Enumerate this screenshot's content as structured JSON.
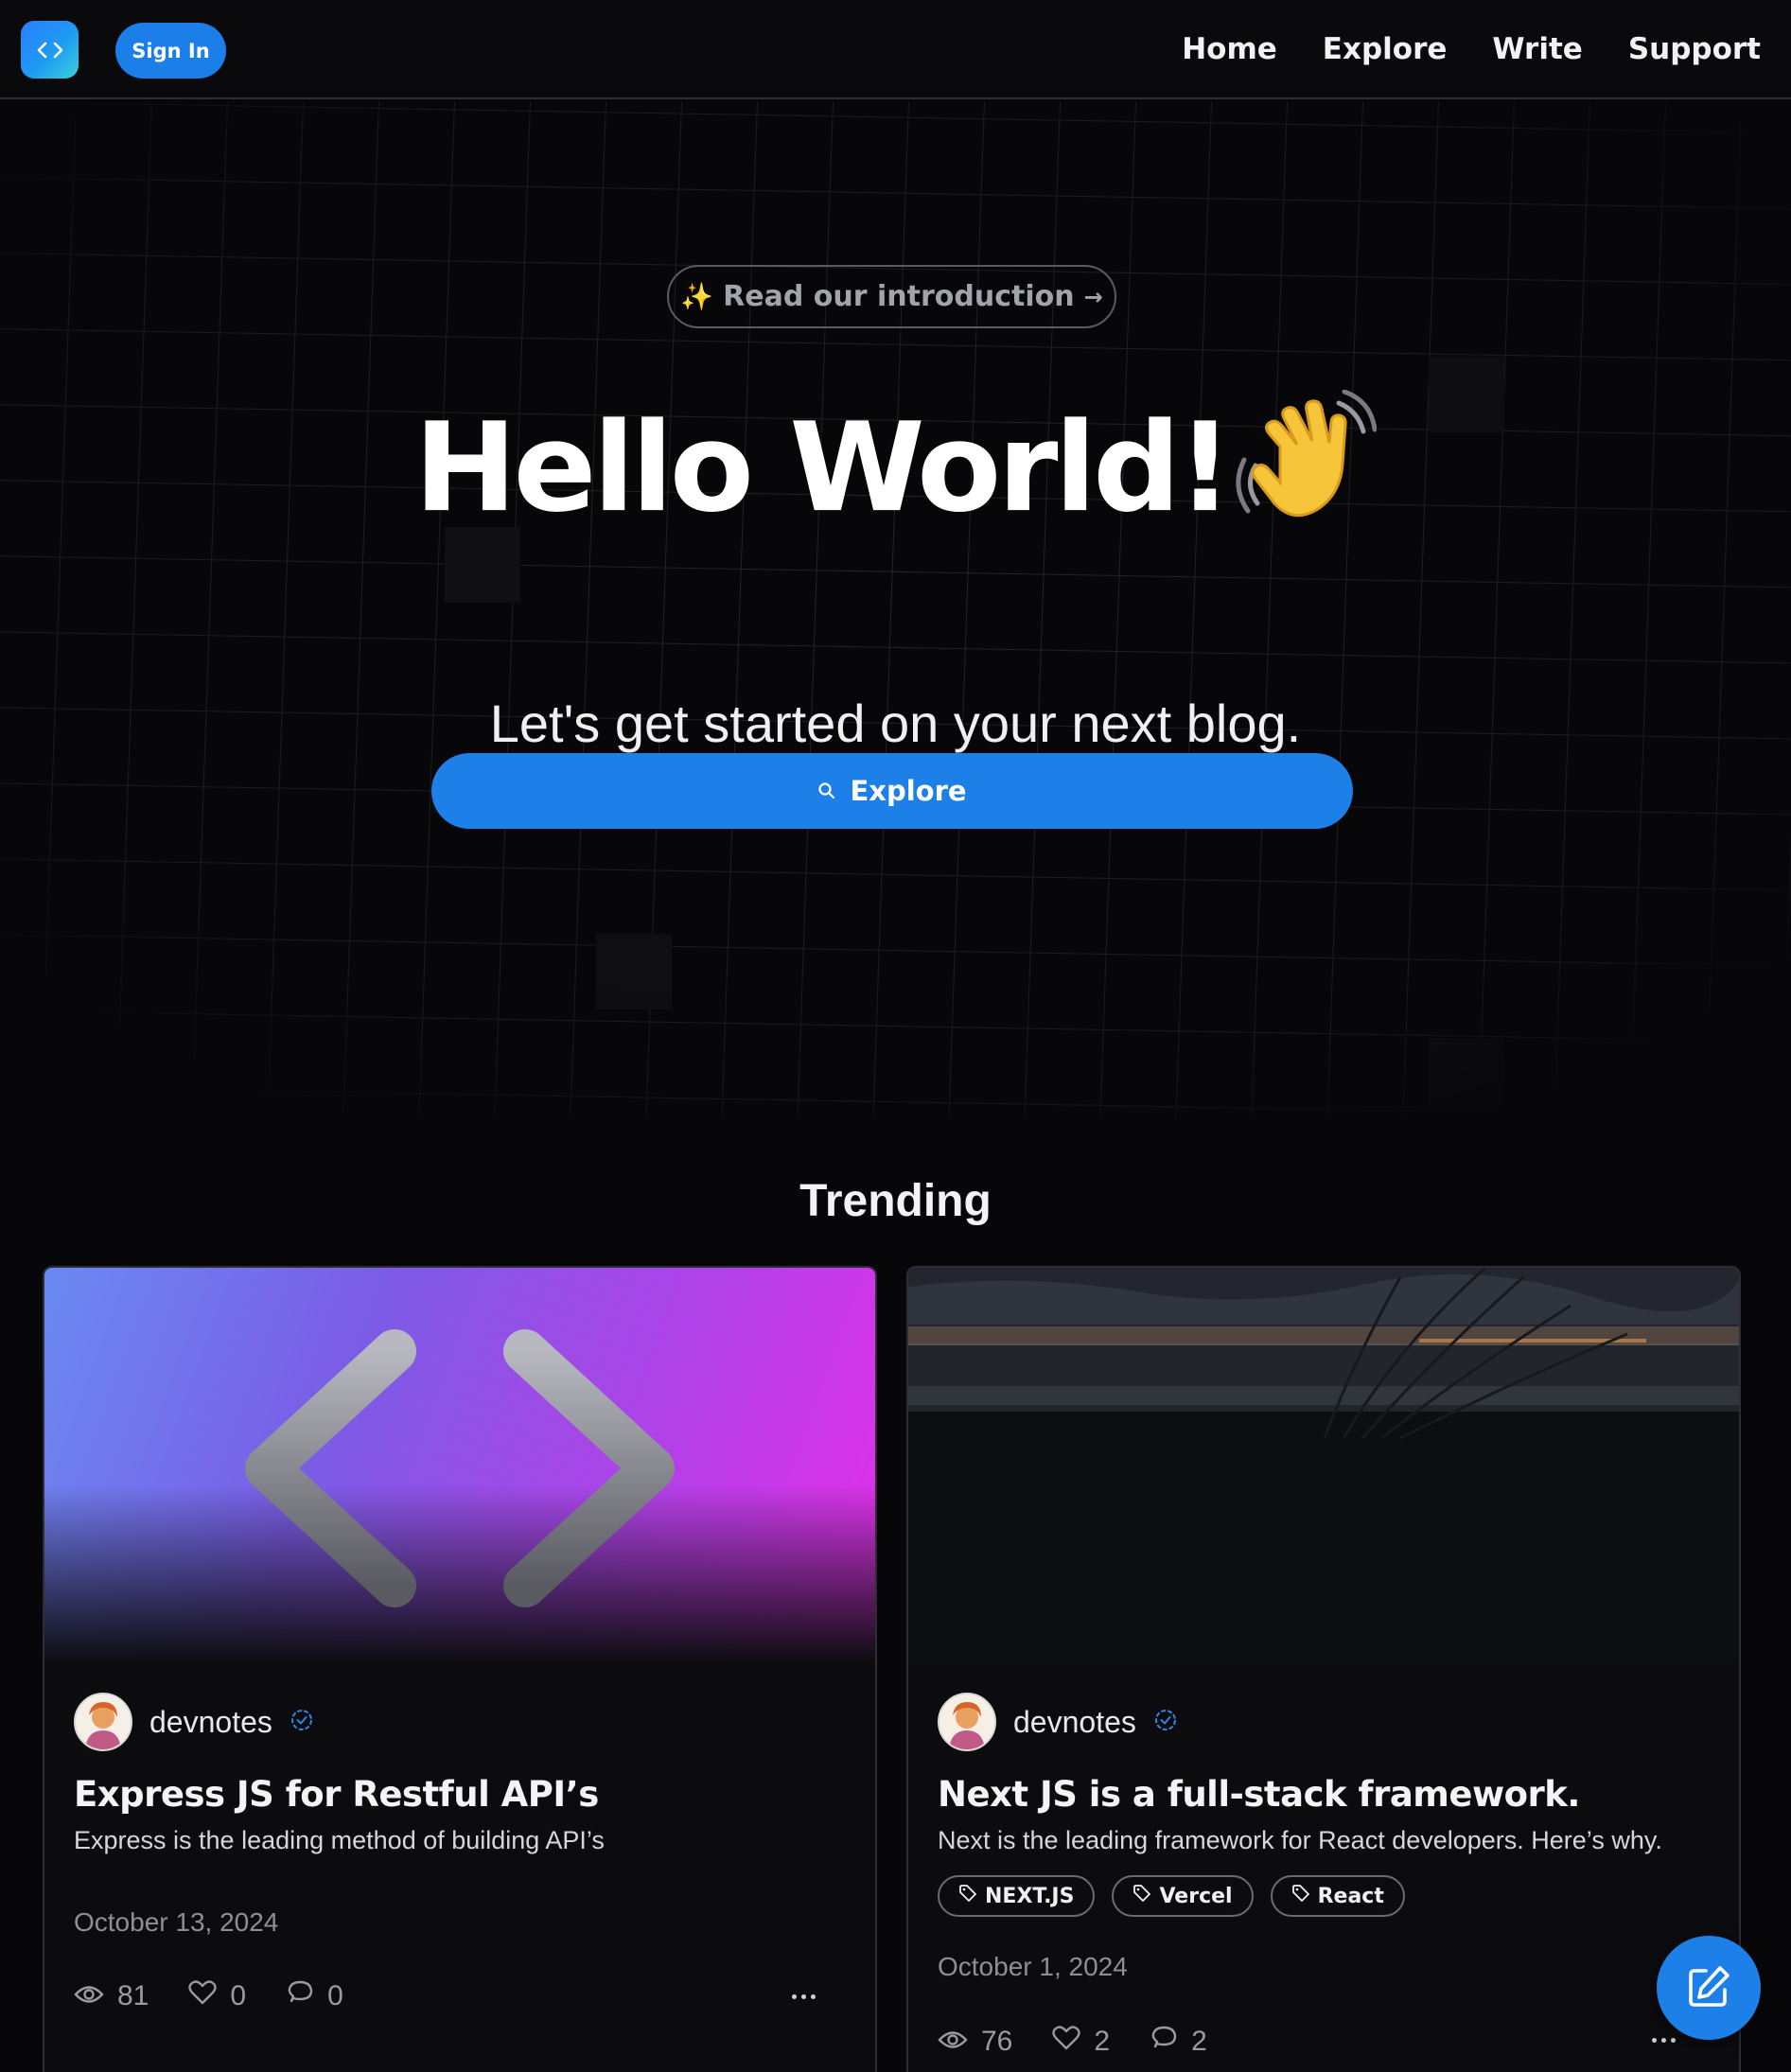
{
  "nav": {
    "sign_in": "Sign In",
    "links": [
      "Home",
      "Explore",
      "Write",
      "Support"
    ]
  },
  "hero": {
    "intro_link": "Read our introduction",
    "title": "Hello World!",
    "subtitle": "Let's get started on your next blog.",
    "explore_button": "Explore"
  },
  "trending": {
    "heading": "Trending",
    "posts": [
      {
        "author": "devnotes",
        "title": "Express JS for Restful API’s",
        "description": "Express is the leading method of building API’s",
        "tags": [],
        "date": "October 13, 2024",
        "views": "81",
        "likes": "0",
        "comments": "0"
      },
      {
        "author": "devnotes",
        "title": "Next JS is a full-stack framework.",
        "description": "Next is the leading framework for React developers. Here’s why.",
        "tags": [
          "NEXT.JS",
          "Vercel",
          "React"
        ],
        "date": "October 1, 2024",
        "views": "76",
        "likes": "2",
        "comments": "2"
      }
    ]
  },
  "colors": {
    "accent": "#1c80e8",
    "background": "#070709",
    "card_bg": "#0c0c0f",
    "muted_text": "#8e8e96"
  },
  "icons": [
    "code-icon",
    "sparkle-icon",
    "arrow-right-icon",
    "waving-hand-icon",
    "search-icon",
    "verified-badge-icon",
    "tag-icon",
    "eye-icon",
    "heart-icon",
    "comment-icon",
    "more-icon",
    "edit-icon"
  ]
}
